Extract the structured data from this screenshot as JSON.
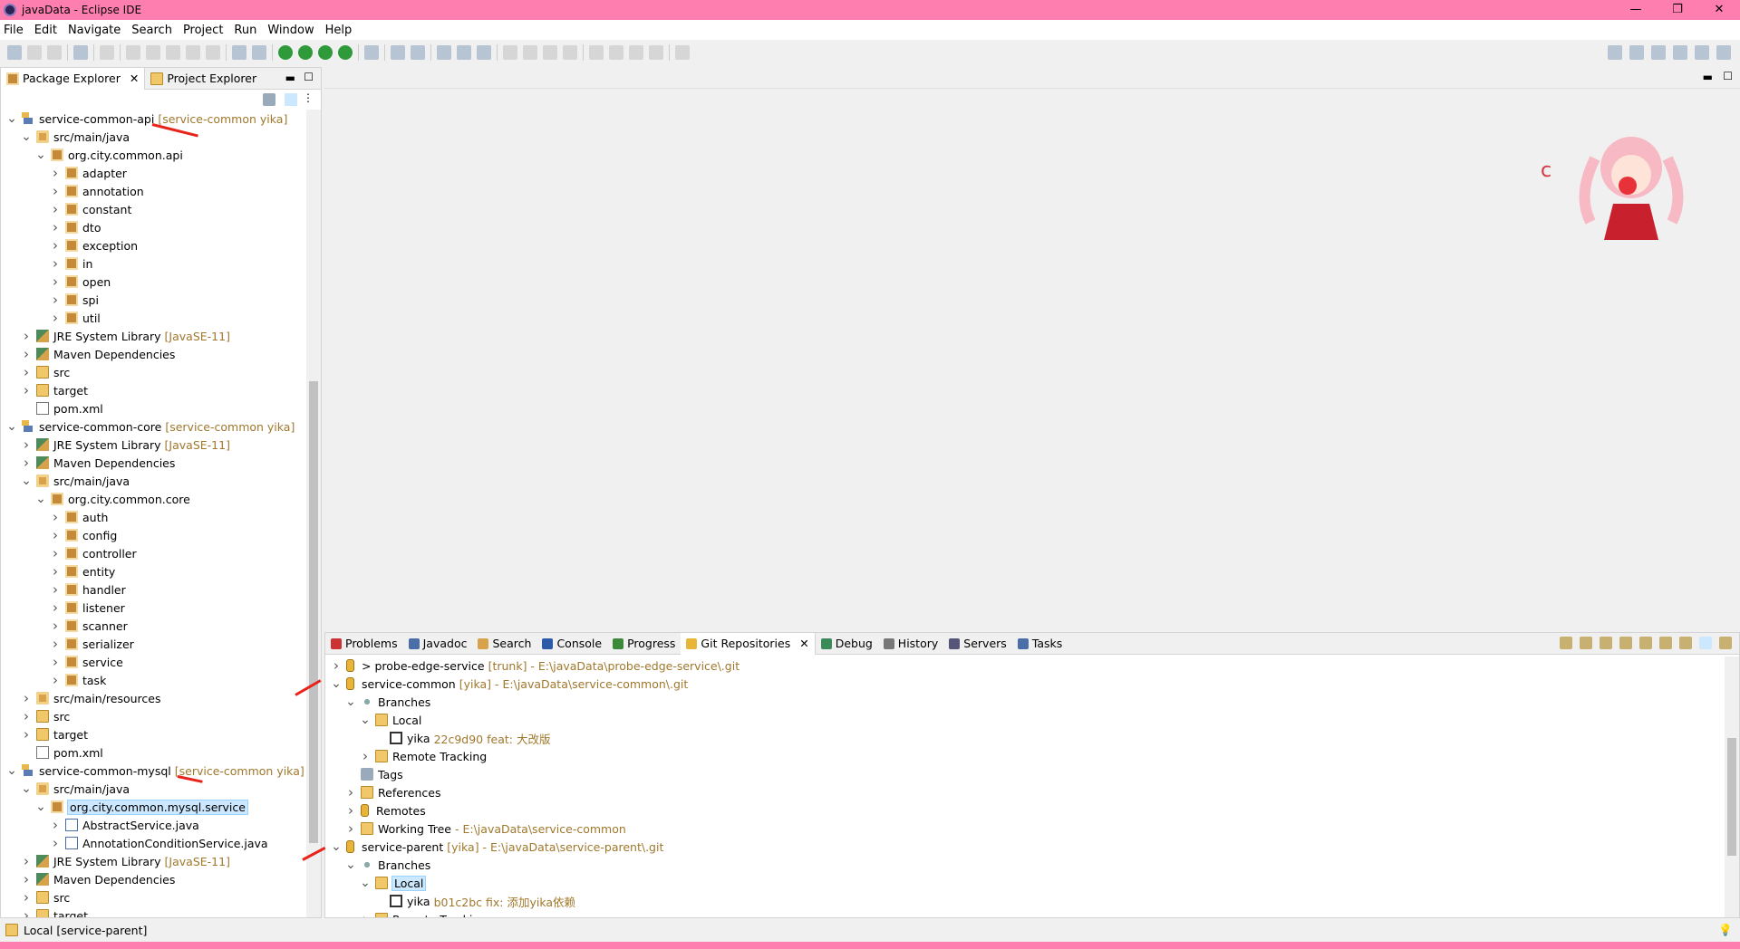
{
  "window": {
    "title": "javaData - Eclipse IDE",
    "min": "—",
    "max": "❐",
    "close": "✕"
  },
  "menu": [
    "File",
    "Edit",
    "Navigate",
    "Search",
    "Project",
    "Run",
    "Window",
    "Help"
  ],
  "left_panel": {
    "tabs": [
      {
        "label": "Package Explorer",
        "close": "✕"
      },
      {
        "label": "Project Explorer"
      }
    ],
    "tree": [
      {
        "l": 0,
        "t": "v",
        "i": "proj",
        "label": "service-common-api",
        "dec": "[service-common yika]"
      },
      {
        "l": 1,
        "t": "v",
        "i": "src",
        "label": "src/main/java"
      },
      {
        "l": 2,
        "t": "v",
        "i": "pkg",
        "label": "org.city.common.api"
      },
      {
        "l": 3,
        "t": ">",
        "i": "pkg",
        "label": "adapter"
      },
      {
        "l": 3,
        "t": ">",
        "i": "pkg",
        "label": "annotation"
      },
      {
        "l": 3,
        "t": ">",
        "i": "pkg",
        "label": "constant"
      },
      {
        "l": 3,
        "t": ">",
        "i": "pkg",
        "label": "dto"
      },
      {
        "l": 3,
        "t": ">",
        "i": "pkg",
        "label": "exception"
      },
      {
        "l": 3,
        "t": ">",
        "i": "pkg",
        "label": "in"
      },
      {
        "l": 3,
        "t": ">",
        "i": "pkg",
        "label": "open"
      },
      {
        "l": 3,
        "t": ">",
        "i": "pkg",
        "label": "spi"
      },
      {
        "l": 3,
        "t": ">",
        "i": "pkg",
        "label": "util"
      },
      {
        "l": 1,
        "t": ">",
        "i": "lib",
        "label": "JRE System Library",
        "dec": "[JavaSE-11]"
      },
      {
        "l": 1,
        "t": ">",
        "i": "lib",
        "label": "Maven Dependencies"
      },
      {
        "l": 1,
        "t": ">",
        "i": "folder",
        "label": "src"
      },
      {
        "l": 1,
        "t": ">",
        "i": "folder",
        "label": "target"
      },
      {
        "l": 1,
        "t": "",
        "i": "xml",
        "label": "pom.xml"
      },
      {
        "l": 0,
        "t": "v",
        "i": "proj",
        "label": "service-common-core",
        "dec": "[service-common yika]"
      },
      {
        "l": 1,
        "t": ">",
        "i": "lib",
        "label": "JRE System Library",
        "dec": "[JavaSE-11]"
      },
      {
        "l": 1,
        "t": ">",
        "i": "lib",
        "label": "Maven Dependencies"
      },
      {
        "l": 1,
        "t": "v",
        "i": "src",
        "label": "src/main/java"
      },
      {
        "l": 2,
        "t": "v",
        "i": "pkg",
        "label": "org.city.common.core"
      },
      {
        "l": 3,
        "t": ">",
        "i": "pkg",
        "label": "auth"
      },
      {
        "l": 3,
        "t": ">",
        "i": "pkg",
        "label": "config"
      },
      {
        "l": 3,
        "t": ">",
        "i": "pkg",
        "label": "controller"
      },
      {
        "l": 3,
        "t": ">",
        "i": "pkg",
        "label": "entity"
      },
      {
        "l": 3,
        "t": ">",
        "i": "pkg",
        "label": "handler"
      },
      {
        "l": 3,
        "t": ">",
        "i": "pkg",
        "label": "listener"
      },
      {
        "l": 3,
        "t": ">",
        "i": "pkg",
        "label": "scanner"
      },
      {
        "l": 3,
        "t": ">",
        "i": "pkg",
        "label": "serializer"
      },
      {
        "l": 3,
        "t": ">",
        "i": "pkg",
        "label": "service"
      },
      {
        "l": 3,
        "t": ">",
        "i": "pkg",
        "label": "task"
      },
      {
        "l": 1,
        "t": ">",
        "i": "src",
        "label": "src/main/resources"
      },
      {
        "l": 1,
        "t": ">",
        "i": "folder",
        "label": "src"
      },
      {
        "l": 1,
        "t": ">",
        "i": "folder",
        "label": "target"
      },
      {
        "l": 1,
        "t": "",
        "i": "xml",
        "label": "pom.xml"
      },
      {
        "l": 0,
        "t": "v",
        "i": "proj",
        "label": "service-common-mysql",
        "dec": "[service-common yika]"
      },
      {
        "l": 1,
        "t": "v",
        "i": "src",
        "label": "src/main/java"
      },
      {
        "l": 2,
        "t": "v",
        "i": "pkg",
        "label": "org.city.common.mysql.service",
        "sel": true
      },
      {
        "l": 3,
        "t": ">",
        "i": "java",
        "label": "AbstractService.java"
      },
      {
        "l": 3,
        "t": ">",
        "i": "java",
        "label": "AnnotationConditionService.java"
      },
      {
        "l": 1,
        "t": ">",
        "i": "lib",
        "label": "JRE System Library",
        "dec": "[JavaSE-11]"
      },
      {
        "l": 1,
        "t": ">",
        "i": "lib",
        "label": "Maven Dependencies"
      },
      {
        "l": 1,
        "t": ">",
        "i": "folder",
        "label": "src"
      },
      {
        "l": 1,
        "t": ">",
        "i": "folder",
        "label": "target"
      }
    ]
  },
  "bottom_panel": {
    "tabs": [
      {
        "label": "Problems"
      },
      {
        "label": "Javadoc"
      },
      {
        "label": "Search"
      },
      {
        "label": "Console"
      },
      {
        "label": "Progress"
      },
      {
        "label": "Git Repositories",
        "active": true,
        "close": "✕"
      },
      {
        "label": "Debug"
      },
      {
        "label": "History"
      },
      {
        "label": "Servers"
      },
      {
        "label": "Tasks"
      }
    ],
    "tree": [
      {
        "l": 0,
        "t": ">",
        "i": "repo",
        "label": "> probe-edge-service",
        "dec": "[trunk] - E:\\javaData\\probe-edge-service\\.git"
      },
      {
        "l": 0,
        "t": "v",
        "i": "repo",
        "label": "service-common",
        "dec": "[yika] - E:\\javaData\\service-common\\.git"
      },
      {
        "l": 1,
        "t": "v",
        "i": "branch",
        "label": "Branches"
      },
      {
        "l": 2,
        "t": "v",
        "i": "folder",
        "label": "Local"
      },
      {
        "l": 3,
        "t": "",
        "i": "bitem",
        "label": "yika",
        "dec": "22c9d90 feat: 大改版"
      },
      {
        "l": 2,
        "t": ">",
        "i": "folder",
        "label": "Remote Tracking"
      },
      {
        "l": 1,
        "t": "",
        "i": "tag",
        "label": "Tags"
      },
      {
        "l": 1,
        "t": ">",
        "i": "folder",
        "label": "References"
      },
      {
        "l": 1,
        "t": ">",
        "i": "repo",
        "label": "Remotes"
      },
      {
        "l": 1,
        "t": ">",
        "i": "folder",
        "label": "Working Tree",
        "dec": "- E:\\javaData\\service-common"
      },
      {
        "l": 0,
        "t": "v",
        "i": "repo",
        "label": "service-parent",
        "dec": "[yika] - E:\\javaData\\service-parent\\.git"
      },
      {
        "l": 1,
        "t": "v",
        "i": "branch",
        "label": "Branches"
      },
      {
        "l": 2,
        "t": "v",
        "i": "folder",
        "label": "Local",
        "sel": true
      },
      {
        "l": 3,
        "t": "",
        "i": "bitem",
        "label": "yika",
        "dec": "b01c2bc fix: 添加yika依赖"
      },
      {
        "l": 2,
        "t": ">",
        "i": "folder",
        "label": "Remote Tracking"
      }
    ]
  },
  "status": {
    "text": "Local [service-parent]"
  }
}
